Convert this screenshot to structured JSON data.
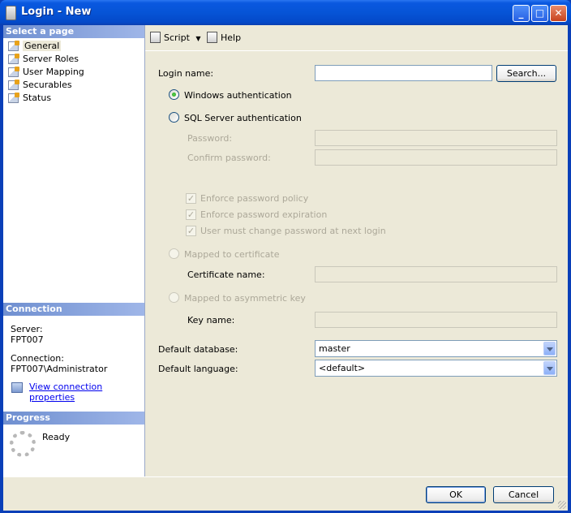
{
  "window": {
    "title": "Login - New",
    "min_label": "_",
    "max_label": "□",
    "close_label": "✕"
  },
  "sidebar": {
    "select_page_header": "Select a page",
    "items": [
      {
        "label": "General",
        "selected": true
      },
      {
        "label": "Server Roles"
      },
      {
        "label": "User Mapping"
      },
      {
        "label": "Securables"
      },
      {
        "label": "Status"
      }
    ],
    "connection_header": "Connection",
    "server_label": "Server:",
    "server_value": "FPT007",
    "connection_label": "Connection:",
    "connection_value": "FPT007\\Administrator",
    "view_connection_link": "View connection properties",
    "progress_header": "Progress",
    "progress_status": "Ready"
  },
  "toolbar": {
    "script_label": "Script",
    "help_label": "Help"
  },
  "form": {
    "login_name_label": "Login name:",
    "login_name_value": "",
    "search_button": "Search...",
    "windows_auth_label": "Windows authentication",
    "sql_auth_label": "SQL Server authentication",
    "password_label": "Password:",
    "confirm_password_label": "Confirm password:",
    "enforce_policy_label": "Enforce password policy",
    "enforce_expiration_label": "Enforce password expiration",
    "must_change_label": "User must change password at next login",
    "mapped_cert_label": "Mapped to certificate",
    "cert_name_label": "Certificate name:",
    "mapped_asym_label": "Mapped to asymmetric key",
    "key_name_label": "Key name:",
    "default_db_label": "Default database:",
    "default_db_value": "master",
    "default_lang_label": "Default language:",
    "default_lang_value": "<default>"
  },
  "footer": {
    "ok_label": "OK",
    "cancel_label": "Cancel"
  }
}
